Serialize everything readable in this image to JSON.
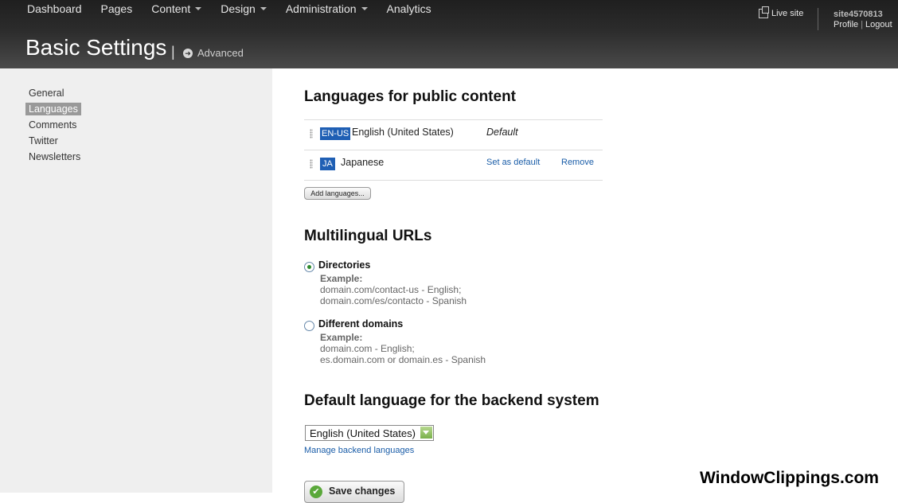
{
  "header": {
    "nav": [
      {
        "label": "Dashboard",
        "dropdown": false
      },
      {
        "label": "Pages",
        "dropdown": false
      },
      {
        "label": "Content",
        "dropdown": true
      },
      {
        "label": "Design",
        "dropdown": true
      },
      {
        "label": "Administration",
        "dropdown": true
      },
      {
        "label": "Analytics",
        "dropdown": false
      }
    ],
    "title": "Basic Settings",
    "title_separator": "|",
    "advanced_label": "Advanced",
    "live_site_label": "Live site",
    "username": "site4570813",
    "profile_label": "Profile",
    "link_separator": "|",
    "logout_label": "Logout"
  },
  "sidebar": {
    "items": [
      {
        "label": "General",
        "active": false
      },
      {
        "label": "Languages",
        "active": true
      },
      {
        "label": "Comments",
        "active": false
      },
      {
        "label": "Twitter",
        "active": false
      },
      {
        "label": "Newsletters",
        "active": false
      }
    ]
  },
  "languages": {
    "heading": "Languages for public content",
    "rows": [
      {
        "code": "EN-US",
        "name": "English (United States)",
        "default_label": "Default"
      },
      {
        "code": "JA",
        "name": "Japanese",
        "set_default_label": "Set as default",
        "remove_label": "Remove"
      }
    ],
    "add_button": "Add languages..."
  },
  "urls": {
    "heading": "Multilingual URLs",
    "options": [
      {
        "label": "Directories",
        "checked": true,
        "example_title": "Example:",
        "example_lines": [
          "domain.com/contact-us - English;",
          "domain.com/es/contacto - Spanish"
        ]
      },
      {
        "label": "Different domains",
        "checked": false,
        "example_title": "Example:",
        "example_lines": [
          "domain.com - English;",
          "es.domain.com or domain.es - Spanish"
        ]
      }
    ]
  },
  "backend": {
    "heading": "Default language for the backend system",
    "selected": "English (United States)",
    "manage_link": "Manage backend languages"
  },
  "save_button": "Save changes",
  "watermark": "WindowClippings.com",
  "colors": {
    "header_dark": "#1f1f1f",
    "sidebar_bg": "#efefef",
    "active_item_bg": "#999999",
    "language_code_bg": "#1f5fb4",
    "link": "#1a5da8"
  }
}
